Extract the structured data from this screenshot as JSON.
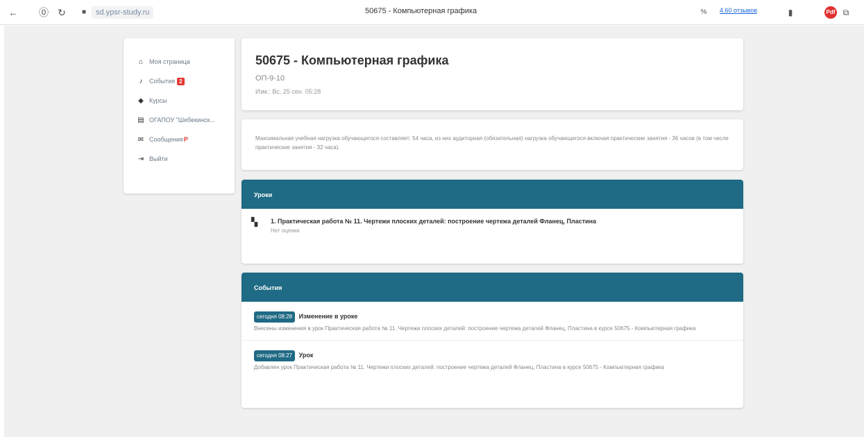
{
  "browser": {
    "url": "sd.ypsr-study.ru",
    "title": "50675 - Компьютерная графика",
    "reviews": "4.60 отзывов",
    "badge": "Pdf",
    "translate": "%"
  },
  "sidebar": {
    "items": [
      {
        "label": "Моя страница",
        "icon": "home-icon"
      },
      {
        "label": "События",
        "icon": "bell-icon",
        "badge": "2"
      },
      {
        "label": "Курсы",
        "icon": "graduation-cap-icon"
      },
      {
        "label": "ОГАПОУ \"Шебекинск...",
        "icon": "building-icon"
      },
      {
        "label": "Сообщения",
        "icon": "chat-icon",
        "flag": "P"
      },
      {
        "label": "Выйти",
        "icon": "logout-icon"
      }
    ]
  },
  "course": {
    "title": "50675 - Компьютерная графика",
    "group": "ОП-9-10",
    "changed": "Изм.: Вс, 25 сен. 05:28"
  },
  "description": "Максимальная учебная нагрузка обучающегося составляет: 54 часа, из них аудиторная (обязательная) нагрузка обучающегося включая практические занятия - 36 часов (в том числе практические занятия - 32 часа).",
  "lessons": {
    "header": "Уроки",
    "items": [
      {
        "title": "1. Практическая работа № 11. Чертежи плоских деталей: построение чертежа деталей Фланец, Пластина",
        "grade": "Нет оценки"
      }
    ]
  },
  "events": {
    "header": "События",
    "items": [
      {
        "time": "сегодня 08:28",
        "name": "Изменение в уроке",
        "desc": "Внесены изменения в урок Практическая работа № 11. Чертежи плоских деталей: построение чертежа деталей Фланец, Пластина в курсе 50675 - Компьютерная графика"
      },
      {
        "time": "сегодня 08:27",
        "name": "Урок",
        "desc": "Добавлен урок Практическая работа № 11. Чертежи плоских деталей: построение чертежа деталей Фланец, Пластина в курсе 50675 - Компьютерная графика"
      }
    ]
  },
  "colors": {
    "header_bg": "#1f6a84",
    "badge_red": "#e53935"
  }
}
